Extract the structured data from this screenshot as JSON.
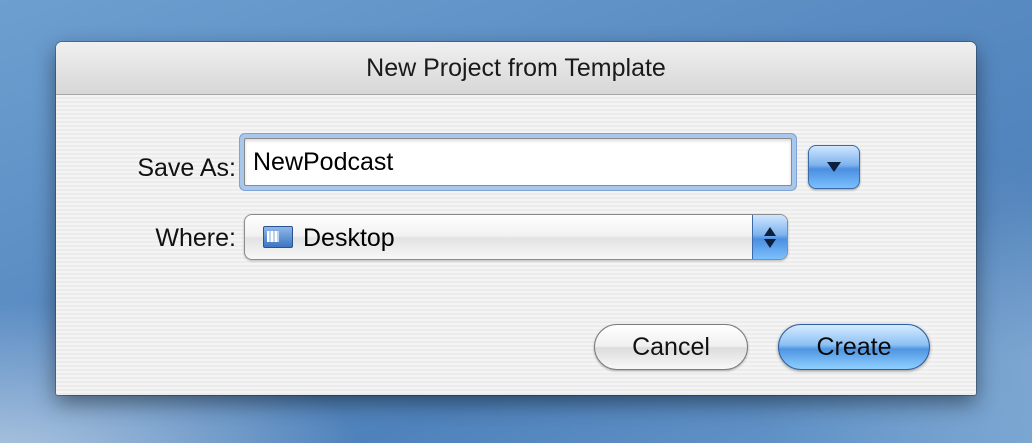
{
  "dialog": {
    "title": "New Project from Template",
    "save_as_label": "Save As:",
    "save_as_value": "NewPodcast",
    "where_label": "Where:",
    "where_value": "Desktop",
    "where_icon": "desktop-folder-icon",
    "cancel_label": "Cancel",
    "create_label": "Create",
    "accent_color": "#5a9be6"
  }
}
